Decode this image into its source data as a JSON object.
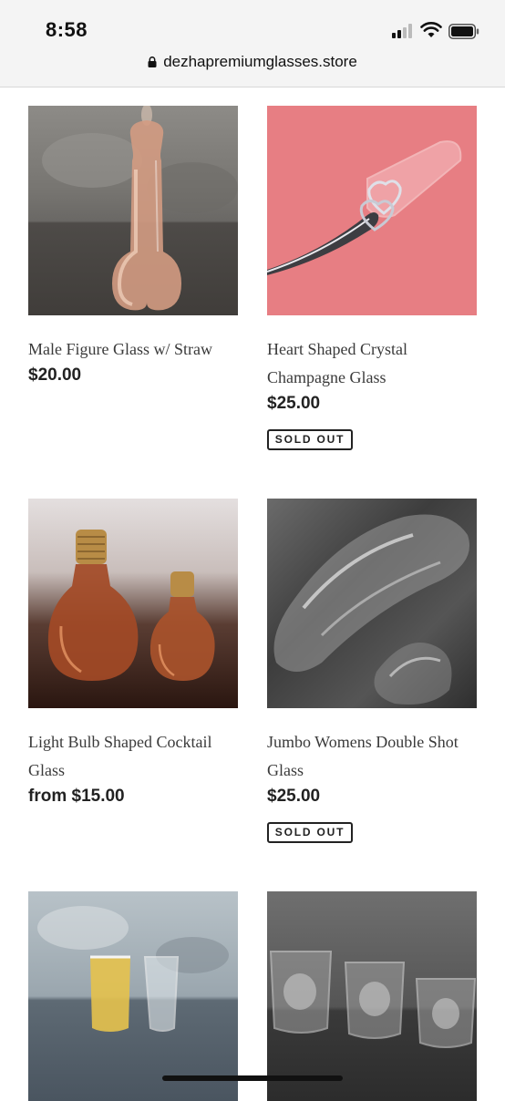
{
  "status_bar": {
    "time": "8:58",
    "signal_icon": "cellular-signal-icon",
    "wifi_icon": "wifi-icon",
    "battery_icon": "battery-icon"
  },
  "browser": {
    "url": "dezhapremiumglasses.store",
    "lock_icon": "lock-icon"
  },
  "products": [
    {
      "title": "Male Figure Glass w/ Straw",
      "price": "$20.00",
      "sold_out": ""
    },
    {
      "title": "Heart Shaped Crystal Champagne Glass",
      "price": "$25.00",
      "sold_out": "SOLD OUT"
    },
    {
      "title": "Light Bulb Shaped Cocktail Glass",
      "price": "from $15.00",
      "sold_out": ""
    },
    {
      "title": "Jumbo Womens Double Shot Glass",
      "price": "$25.00",
      "sold_out": "SOLD OUT"
    },
    {
      "title": "",
      "price": "",
      "sold_out": ""
    },
    {
      "title": "",
      "price": "",
      "sold_out": ""
    }
  ],
  "colors": {
    "status_bar_bg": "#f4f4f4",
    "text": "#222222",
    "title_text": "#3a3a3a",
    "champagne_bg": "#e77e83"
  }
}
